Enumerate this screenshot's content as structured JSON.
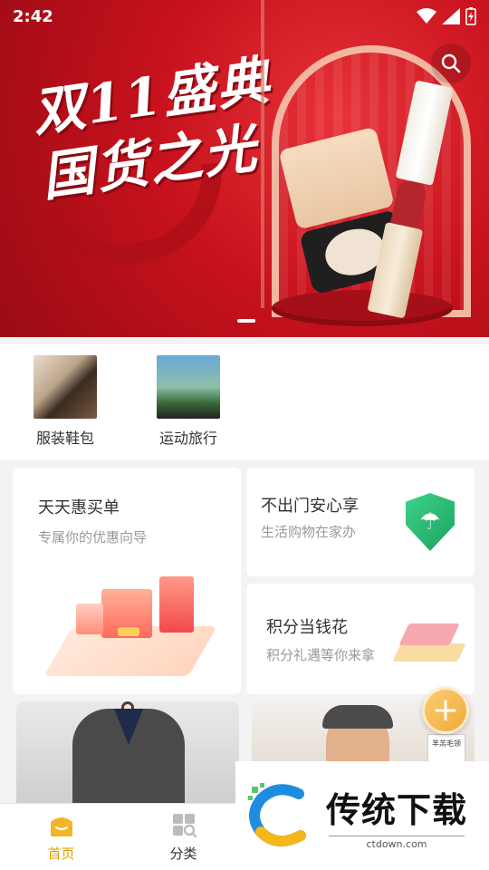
{
  "status_bar": {
    "time": "2:42"
  },
  "banner": {
    "title_line1": "双11盛典",
    "title_line2": "国货之光",
    "search_icon": "search-icon",
    "active_slide": 1
  },
  "categories": [
    {
      "label": "服装鞋包",
      "image": "fashion-shoes-photo"
    },
    {
      "label": "运动旅行",
      "image": "cycling-photo"
    }
  ],
  "promo_cards": {
    "main": {
      "title": "天天惠买单",
      "subtitle": "专属你的优惠向导"
    },
    "right_top": {
      "title": "不出门安心享",
      "subtitle": "生活购物在家办"
    },
    "right_bottom": {
      "title": "积分当钱花",
      "subtitle": "积分礼遇等你来拿"
    }
  },
  "products": {
    "second_tag_text": "羊羔毛领"
  },
  "fab": {
    "label": "+"
  },
  "bottom_nav": {
    "items": [
      {
        "label": "首页",
        "icon": "home-icon",
        "active": true
      },
      {
        "label": "分类",
        "icon": "category-icon",
        "active": false
      }
    ]
  },
  "watermark": {
    "title": "传统下载",
    "url": "ctdown.com"
  },
  "colors": {
    "accent": "#e0a100",
    "banner_red": "#c8121d",
    "shield_green": "#19a35e"
  }
}
